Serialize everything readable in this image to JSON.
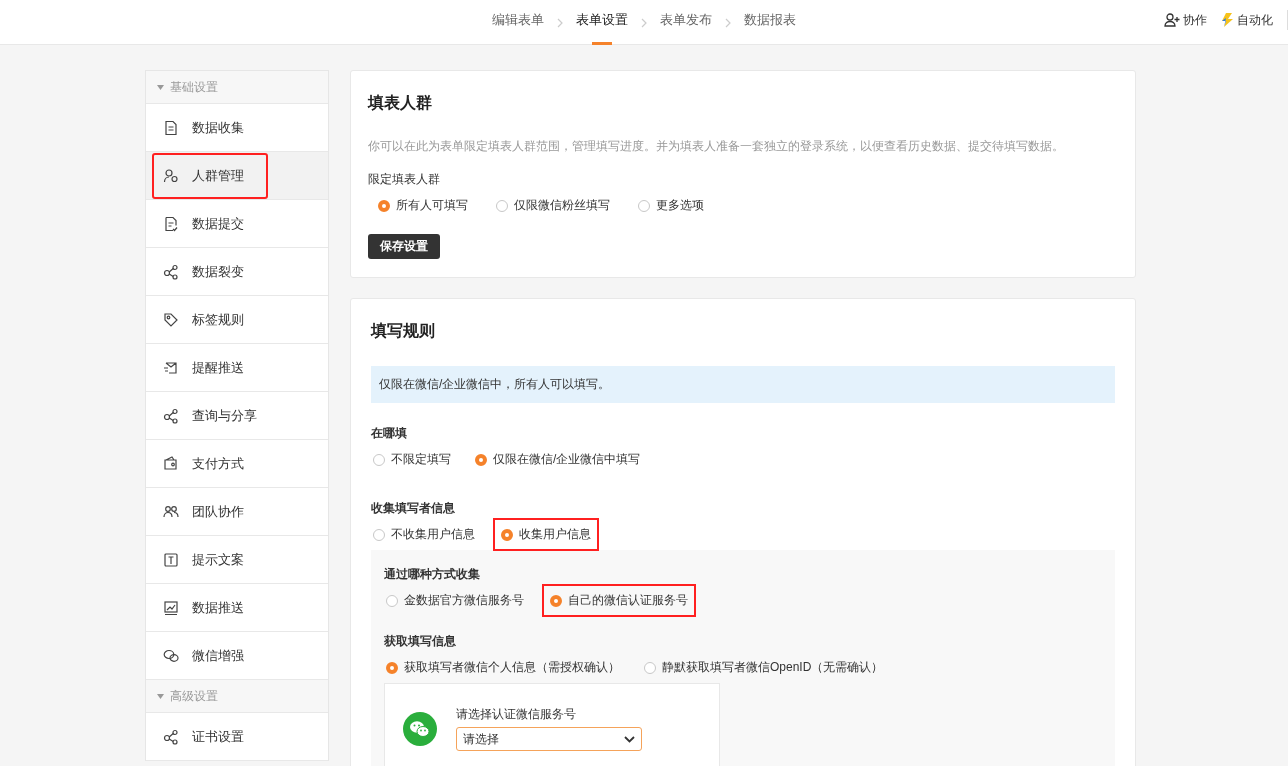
{
  "steps": [
    {
      "label": "编辑表单",
      "selected": false
    },
    {
      "label": "表单设置",
      "selected": true
    },
    {
      "label": "表单发布",
      "selected": false
    },
    {
      "label": "数据报表",
      "selected": false
    }
  ],
  "actions": [
    {
      "label": "协作",
      "kind": "user-add"
    },
    {
      "label": "自动化",
      "kind": "bolt"
    }
  ],
  "sidebar": {
    "groups": [
      {
        "title": "基础设置",
        "expanded": true,
        "items": [
          {
            "label": "数据收集",
            "selected": false,
            "highlighted": false
          },
          {
            "label": "人群管理",
            "selected": true,
            "highlighted": true
          },
          {
            "label": "数据提交",
            "selected": false,
            "highlighted": false
          },
          {
            "label": "数据裂变",
            "selected": false,
            "highlighted": false
          },
          {
            "label": "标签规则",
            "selected": false,
            "highlighted": false
          },
          {
            "label": "提醒推送",
            "selected": false,
            "highlighted": false
          },
          {
            "label": "查询与分享",
            "selected": false,
            "highlighted": false
          },
          {
            "label": "支付方式",
            "selected": false,
            "highlighted": false
          },
          {
            "label": "团队协作",
            "selected": false,
            "highlighted": false
          },
          {
            "label": "提示文案",
            "selected": false,
            "highlighted": false
          },
          {
            "label": "数据推送",
            "selected": false,
            "highlighted": false
          },
          {
            "label": "微信增强",
            "selected": false,
            "highlighted": false
          }
        ]
      },
      {
        "title": "高级设置",
        "expanded": true,
        "items": [
          {
            "label": "证书设置",
            "selected": false,
            "highlighted": false
          }
        ]
      }
    ]
  },
  "audience_card": {
    "title": "填表人群",
    "description": "你可以在此为表单限定填表人群范围，管理填写进度。并为填表人准备一套独立的登录系统，以便查看历史数据、提交待填写数据。",
    "label": "限定填表人群",
    "options": [
      {
        "label": "所有人可填写",
        "selected": true
      },
      {
        "label": "仅限微信粉丝填写",
        "selected": false
      },
      {
        "label": "更多选项",
        "selected": false
      }
    ],
    "save_button": "保存设置"
  },
  "rules_card": {
    "title": "填写规则",
    "notice": "仅限在微信/企业微信中，所有人可以填写。",
    "where": {
      "label": "在哪填",
      "options": [
        {
          "label": "不限定填写",
          "selected": false,
          "highlighted": false
        },
        {
          "label": "仅限在微信/企业微信中填写",
          "selected": true,
          "highlighted": false
        }
      ]
    },
    "collect": {
      "label": "收集填写者信息",
      "options": [
        {
          "label": "不收集用户信息",
          "selected": false,
          "highlighted": false
        },
        {
          "label": "收集用户信息",
          "selected": true,
          "highlighted": true
        }
      ]
    },
    "method": {
      "label": "通过哪种方式收集",
      "options": [
        {
          "label": "金数据官方微信服务号",
          "selected": false,
          "highlighted": false
        },
        {
          "label": "自己的微信认证服务号",
          "selected": true,
          "highlighted": true
        }
      ]
    },
    "fetch": {
      "label": "获取填写信息",
      "options": [
        {
          "label": "获取填写者微信个人信息（需授权确认）",
          "selected": true,
          "highlighted": false
        },
        {
          "label": "静默获取填写者微信OpenID（无需确认）",
          "selected": false,
          "highlighted": false
        }
      ]
    },
    "account_select": {
      "label": "请选择认证微信服务号",
      "value": "请选择"
    }
  }
}
